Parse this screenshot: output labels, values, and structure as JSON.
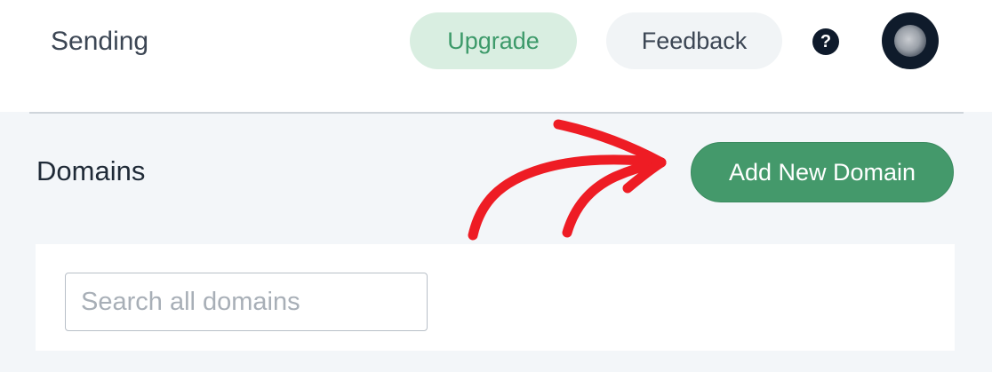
{
  "header": {
    "title": "Sending",
    "upgrade_label": "Upgrade",
    "feedback_label": "Feedback",
    "help_glyph": "?",
    "help_icon": "question-circle-icon",
    "avatar_icon": "user-avatar"
  },
  "domains": {
    "title": "Domains",
    "add_button_label": "Add New Domain",
    "search": {
      "placeholder": "Search all domains",
      "value": ""
    }
  },
  "annotation": {
    "icon": "red-arrow-icon",
    "color": "#ee1c24"
  },
  "colors": {
    "accent": "#44996b",
    "upgrade_bg": "#d9eee1",
    "upgrade_text": "#3d9a6a",
    "page_bg": "#f3f6f9",
    "dark": "#0e1a2b"
  }
}
